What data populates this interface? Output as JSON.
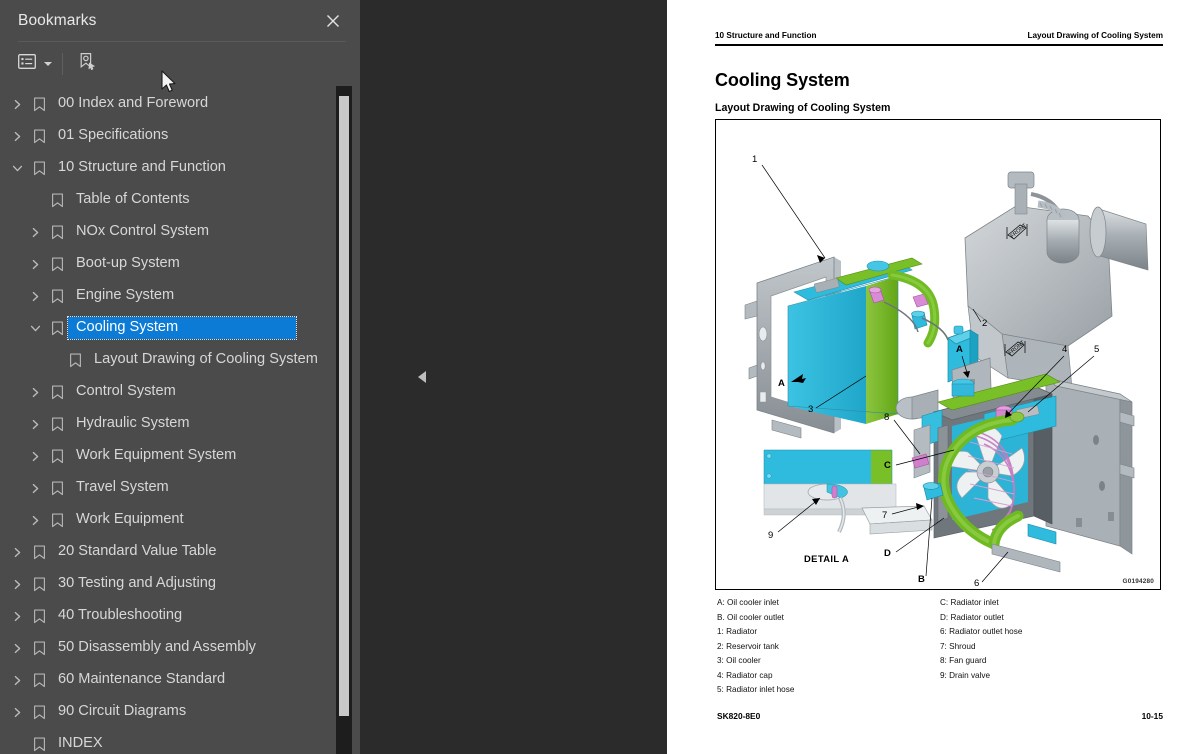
{
  "sidebar": {
    "title": "Bookmarks",
    "close_icon": "close-icon",
    "toolbar": {
      "listview_icon": "list-view-icon",
      "listview_caret_icon": "chevron-down-icon",
      "new_bookmark_icon": "new-bookmark-icon"
    },
    "tree": [
      {
        "label": "00 Index and Foreword",
        "depth": 1,
        "twisty": "collapsed",
        "selected": false
      },
      {
        "label": "01 Specifications",
        "depth": 1,
        "twisty": "collapsed",
        "selected": false
      },
      {
        "label": "10 Structure and Function",
        "depth": 1,
        "twisty": "expanded",
        "selected": false
      },
      {
        "label": "Table of Contents",
        "depth": 2,
        "twisty": "none",
        "selected": false
      },
      {
        "label": "NOx Control System",
        "depth": 2,
        "twisty": "collapsed",
        "selected": false
      },
      {
        "label": "Boot-up System",
        "depth": 2,
        "twisty": "collapsed",
        "selected": false
      },
      {
        "label": "Engine System",
        "depth": 2,
        "twisty": "collapsed",
        "selected": false
      },
      {
        "label": "Cooling System",
        "depth": 2,
        "twisty": "expanded",
        "selected": true
      },
      {
        "label": "Layout Drawing of Cooling System",
        "depth": 3,
        "twisty": "none",
        "selected": false
      },
      {
        "label": "Control System",
        "depth": 2,
        "twisty": "collapsed",
        "selected": false
      },
      {
        "label": "Hydraulic System",
        "depth": 2,
        "twisty": "collapsed",
        "selected": false
      },
      {
        "label": "Work Equipment System",
        "depth": 2,
        "twisty": "collapsed",
        "selected": false
      },
      {
        "label": "Travel System",
        "depth": 2,
        "twisty": "collapsed",
        "selected": false
      },
      {
        "label": "Work Equipment",
        "depth": 2,
        "twisty": "collapsed",
        "selected": false
      },
      {
        "label": "20 Standard Value Table",
        "depth": 1,
        "twisty": "collapsed",
        "selected": false
      },
      {
        "label": "30 Testing and Adjusting",
        "depth": 1,
        "twisty": "collapsed",
        "selected": false
      },
      {
        "label": "40 Troubleshooting",
        "depth": 1,
        "twisty": "collapsed",
        "selected": false
      },
      {
        "label": "50 Disassembly and Assembly",
        "depth": 1,
        "twisty": "collapsed",
        "selected": false
      },
      {
        "label": "60 Maintenance Standard",
        "depth": 1,
        "twisty": "collapsed",
        "selected": false
      },
      {
        "label": "90 Circuit Diagrams",
        "depth": 1,
        "twisty": "collapsed",
        "selected": false
      },
      {
        "label": "INDEX",
        "depth": 1,
        "twisty": "none",
        "selected": false
      }
    ],
    "scrollbar": {
      "name": "vertical-scrollbar"
    },
    "collapse_handle_icon": "chevron-left-icon",
    "selection_color": "#0b7bd5",
    "panel_color": "#4b4b4b"
  },
  "document": {
    "running_head_left": "10 Structure and Function",
    "running_head_right": "Layout Drawing of Cooling System",
    "heading": "Cooling System",
    "subheading": "Layout Drawing of Cooling System",
    "figure_code": "G0194280",
    "detail_label": "DETAIL A",
    "callouts": {
      "c1": "1",
      "c2": "2",
      "c3": "3",
      "c4": "4",
      "c5": "5",
      "c6": "6",
      "c7": "7",
      "c8": "8",
      "c9": "9",
      "cA_left": "A",
      "cA_right": "A",
      "cB": "B",
      "cC": "C",
      "cD": "D",
      "front_tag_left": "FRONT",
      "front_tag_right": "FRONT"
    },
    "legend_left": [
      "A: Oil cooler inlet",
      "B. Oil cooler outlet",
      "1: Radiator",
      "2: Reservoir tank",
      "3: Oil cooler",
      "4: Radiator cap",
      "5: Radiator inlet hose"
    ],
    "legend_right": [
      "C: Radiator inlet",
      "D: Radiator outlet",
      "6: Radiator outlet hose",
      "7: Shroud",
      "8: Fan guard",
      "9: Drain valve"
    ],
    "footer_left": "SK820-8E0",
    "footer_right": "10-15",
    "art_colors": {
      "cyan": "#29b6da",
      "green": "#76bc21",
      "magenta": "#d97fd0",
      "grey_light": "#c9cdd0",
      "grey_mid": "#9aa0a5",
      "grey_dark": "#6d7479"
    }
  }
}
